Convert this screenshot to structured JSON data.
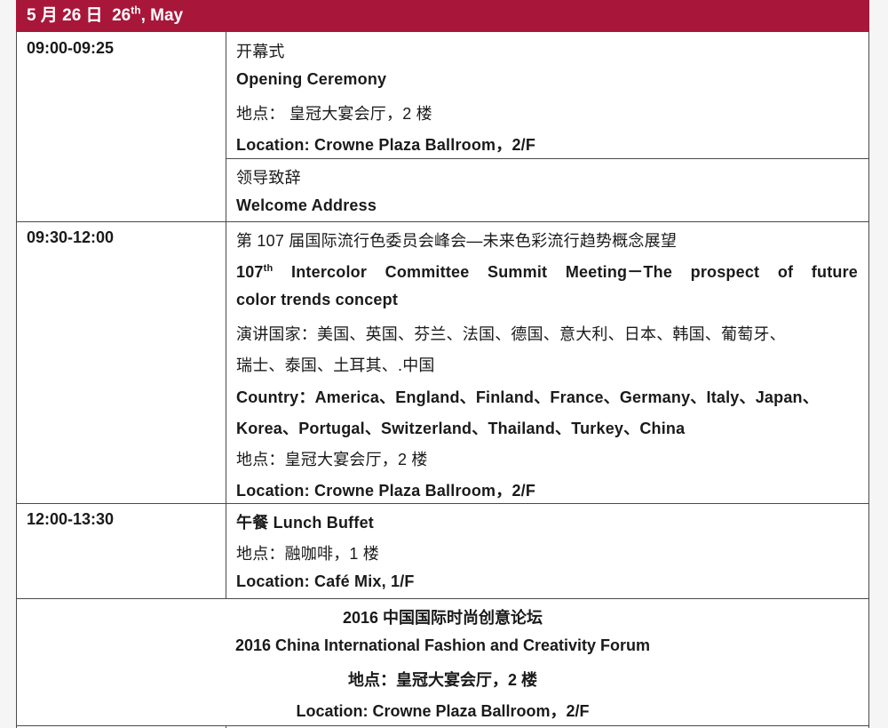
{
  "day": {
    "date_zh": "5 月 26 日",
    "date_en_num": "26",
    "date_en_sup": "th",
    "date_en_month": ", May"
  },
  "rows": [
    {
      "time": "09:00-09:25",
      "items": [
        {
          "zh": "开幕式",
          "en": "Opening Ceremony",
          "loc_zh": "地点： 皇冠大宴会厅，2 楼",
          "loc_en": "Location: Crowne Plaza Ballroom，2/F"
        },
        {
          "zh": "领导致辞",
          "en": "Welcome Address"
        }
      ]
    },
    {
      "time": "09:30-12:00",
      "zh": "第 107 届国际流行色委员会峰会—未来色彩流行趋势概念展望",
      "en_num": "107",
      "en_sup": "th",
      "en_line1_rest": " Intercolor Committee Summit Meeting－The prospect of future",
      "en_line2": "color trends concept",
      "countries_zh_1": "演讲国家：美国、英国、芬兰、法国、德国、意大利、日本、韩国、葡萄牙、",
      "countries_zh_2": "瑞士、泰国、土耳其、.中国",
      "countries_en_1": "Country：America、England、Finland、France、Germany、Italy、Japan、",
      "countries_en_2": "Korea、Portugal、Switzerland、Thailand、Turkey、China",
      "loc_zh": "地点：皇冠大宴会厅，2 楼",
      "loc_en": "Location: Crowne Plaza Ballroom，2/F"
    },
    {
      "time": "12:00-13:30",
      "title": "午餐  Lunch Buffet",
      "loc_zh": "地点：融咖啡，1 楼",
      "loc_en": "Location: Café Mix, 1/F"
    }
  ],
  "forum": {
    "zh": "2016 中国国际时尚创意论坛",
    "en": "2016 China International Fashion and Creativity Forum",
    "loc_zh": "地点：皇冠大宴会厅，2 楼",
    "loc_en": "Location: Crowne Plaza Ballroom，2/F"
  },
  "colors": {
    "header_bg": "#a8173a",
    "header_text": "#ffffff",
    "grid": "#4a4a4a"
  }
}
